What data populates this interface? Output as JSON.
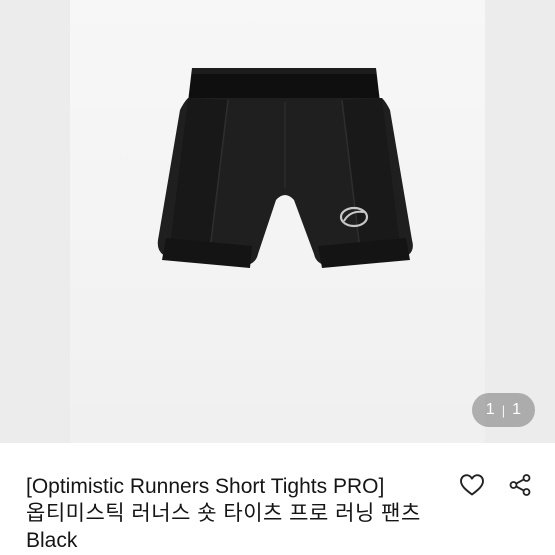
{
  "gallery": {
    "counter": {
      "current": "1",
      "separator": "|",
      "total": "1"
    }
  },
  "product": {
    "title_en": "[Optimistic Runners Short Tights PRO]",
    "title_ko": "옵티미스틱 러너스 숏 타이츠 프로 러닝 팬츠",
    "color": "Black"
  },
  "actions": {
    "like_icon": "heart-outline-icon",
    "share_icon": "share-icon"
  }
}
